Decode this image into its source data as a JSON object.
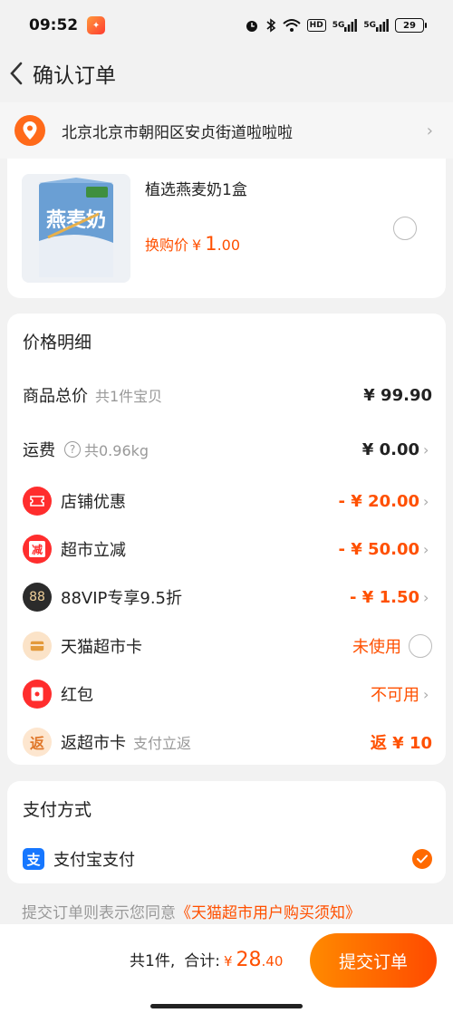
{
  "status_bar": {
    "time": "09:52",
    "battery": "29",
    "net1": "5G",
    "net2": "5G",
    "hd": "HD"
  },
  "header": {
    "title": "确认订单"
  },
  "address": {
    "text": "北京北京市朝阳区安贞街道啦啦啦"
  },
  "product": {
    "name": "植选燕麦奶1盒",
    "price_label": "换购价",
    "currency": "¥",
    "price_int": "1",
    "price_dec": ".00",
    "image_text": "燕麦奶"
  },
  "price_detail": {
    "title": "价格明细",
    "rows": [
      {
        "label": "商品总价",
        "sub": "共1件宝贝",
        "value": "¥ 99.90"
      },
      {
        "label": "运费",
        "sub": "共0.96kg",
        "value": "¥ 0.00"
      },
      {
        "label": "店铺优惠",
        "value": "- ¥ 20.00",
        "icon_text": ""
      },
      {
        "label": "超市立减",
        "value": "- ¥ 50.00",
        "icon_text": "减"
      },
      {
        "label": "88VIP专享9.5折",
        "value": "- ¥ 1.50",
        "icon_text": "88"
      },
      {
        "label": "天猫超市卡",
        "value": "未使用"
      },
      {
        "label": "红包",
        "value": "不可用"
      },
      {
        "label": "返超市卡",
        "sub": "支付立返",
        "value": "返 ¥ 10",
        "icon_text": "返"
      }
    ]
  },
  "payment": {
    "title": "支付方式",
    "method": "支付宝支付",
    "icon_text": "支"
  },
  "agreement": {
    "text": "提交订单则表示您同意",
    "link": "《天猫超市用户购买须知》"
  },
  "bottom": {
    "count": "共1件,",
    "total_label": "合计:",
    "currency": "¥",
    "total_int": "28",
    "total_dec": ".40",
    "submit": "提交订单"
  },
  "colors": {
    "accent": "#ff5000",
    "alipay": "#1677ff"
  }
}
